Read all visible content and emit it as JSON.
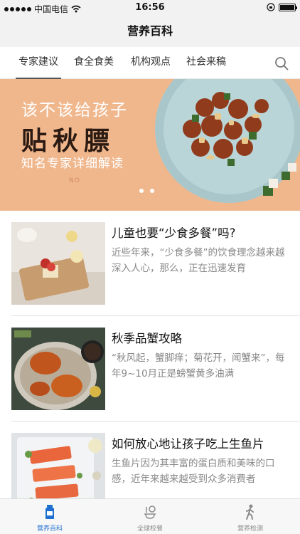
{
  "status_bar": {
    "carrier": "中国电信",
    "time": "16:56"
  },
  "nav": {
    "title": "营养百科"
  },
  "tabs": [
    {
      "label": "专家建议",
      "active": true
    },
    {
      "label": "食全食美",
      "active": false
    },
    {
      "label": "机构观点",
      "active": false
    },
    {
      "label": "社会来稿",
      "active": false
    }
  ],
  "banner": {
    "line1": "该不该给孩子",
    "line2": "贴秋膘",
    "line3": "知名专家详细解读",
    "tag": "NO",
    "page_count": 2,
    "active_page": 1
  },
  "articles": [
    {
      "title": "儿童也要“少食多餐”吗?",
      "summary": "近些年来，“少食多餐”的饮食理念越来越深入人心，那么，正在迅速发育"
    },
    {
      "title": "秋季品蟹攻略",
      "summary": "“秋风起，蟹脚痒；菊花开，闻蟹来”，每年9~10月正是螃蟹黄多油满"
    },
    {
      "title": "如何放心地让孩子吃上生鱼片",
      "summary": "生鱼片因为其丰富的蛋白质和美味的口感，近年来越来越受到众多消费者"
    }
  ],
  "bottom_tabs": [
    {
      "label": "营养百科",
      "icon": "bottle-icon",
      "active": true
    },
    {
      "label": "全球校餐",
      "icon": "globe-meal-icon",
      "active": false
    },
    {
      "label": "营养检测",
      "icon": "person-walk-icon",
      "active": false
    }
  ],
  "colors": {
    "accent": "#1f6fd1",
    "banner_bg": "#f0b78d"
  }
}
